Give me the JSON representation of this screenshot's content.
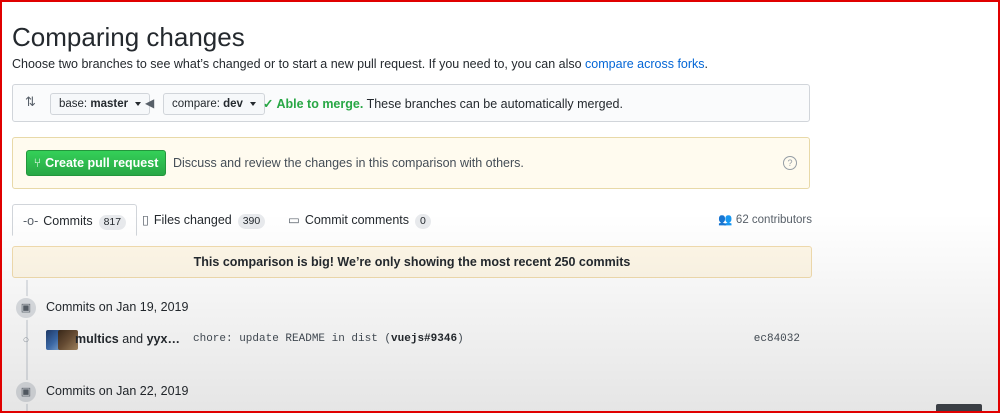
{
  "header": {
    "title": "Comparing changes",
    "subtitle": "Choose two branches to see what’s changed or to start a new pull request. If you need to, you can also",
    "subtitle_link": "compare across forks",
    "subtitle_end": "."
  },
  "range": {
    "base_label": "base:",
    "base_value": "master",
    "compare_label": "compare:",
    "compare_value": "dev",
    "merge_status": "Able to merge.",
    "merge_detail": "These branches can be automatically merged."
  },
  "pull_request": {
    "button_label": "Create pull request",
    "description": "Discuss and review the changes in this comparison with others."
  },
  "tabs": [
    {
      "label": "Commits",
      "count": "817"
    },
    {
      "label": "Files changed",
      "count": "390"
    },
    {
      "label": "Commit comments",
      "count": "0"
    }
  ],
  "contributors": "62 contributors",
  "notice": "This comparison is big! We’re only showing the most recent 250 commits",
  "timeline": [
    {
      "date": "Commits on Jan 19, 2019"
    },
    {
      "date": "Commits on Jan 22, 2019"
    }
  ],
  "commit": {
    "author1": "multics",
    "conjunction": "and",
    "author2": "yyx…",
    "message": "chore: update README in dist (",
    "message_ref": "vuejs#9346",
    "message_end": ")",
    "sha": "ec84032"
  },
  "colors": {
    "accent_link": "#0366d6",
    "success_green": "#28a745",
    "frame_red": "#e00000"
  }
}
